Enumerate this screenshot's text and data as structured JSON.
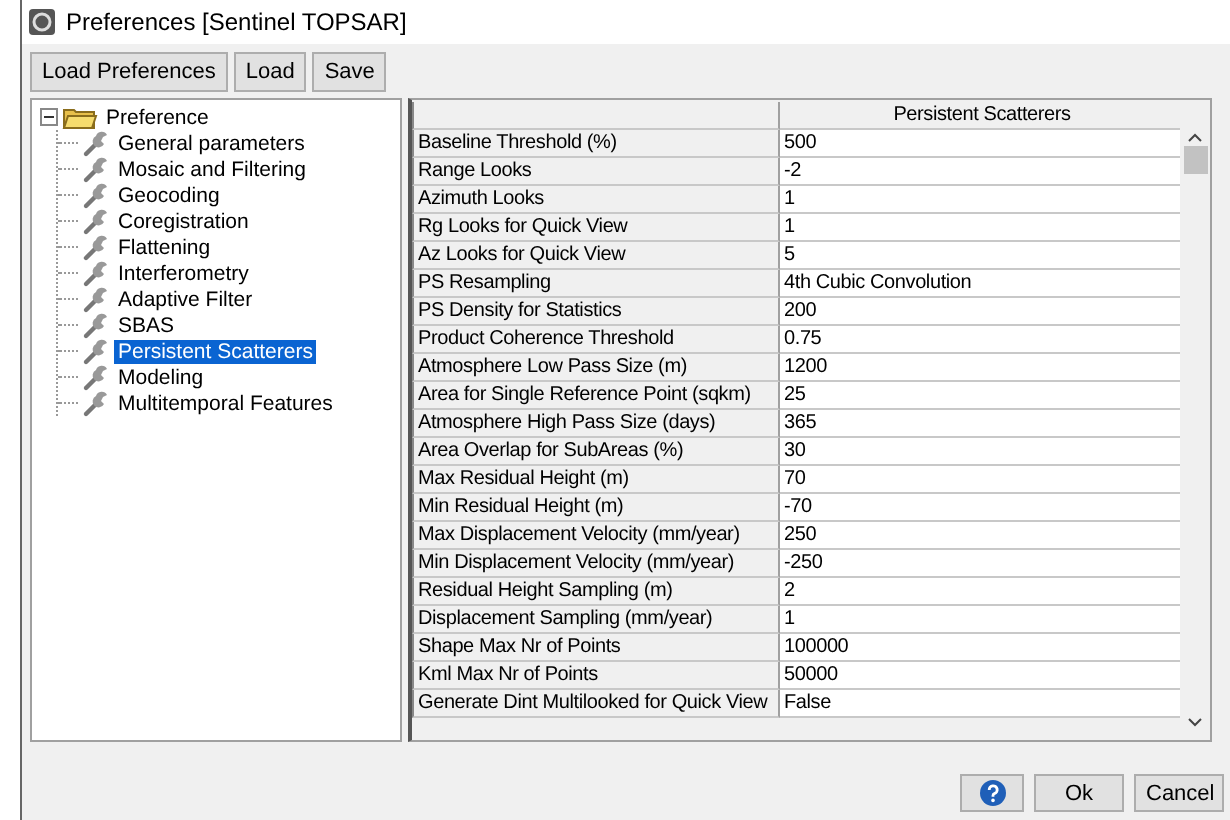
{
  "window": {
    "title": "Preferences [Sentinel TOPSAR]"
  },
  "toolbar": [
    "Load Preferences",
    "Load",
    "Save"
  ],
  "tree": {
    "label": "Preference",
    "expanded": true,
    "children": [
      {
        "label": "General parameters",
        "selected": false
      },
      {
        "label": "Mosaic and Filtering",
        "selected": false
      },
      {
        "label": "Geocoding",
        "selected": false
      },
      {
        "label": "Coregistration",
        "selected": false
      },
      {
        "label": "Flattening",
        "selected": false
      },
      {
        "label": "Interferometry",
        "selected": false
      },
      {
        "label": "Adaptive Filter",
        "selected": false
      },
      {
        "label": "SBAS",
        "selected": false
      },
      {
        "label": "Persistent Scatterers",
        "selected": true
      },
      {
        "label": "Modeling",
        "selected": false
      },
      {
        "label": "Multitemporal Features",
        "selected": false
      }
    ]
  },
  "grid": {
    "column_header": "Persistent Scatterers",
    "rows": [
      {
        "name": "Baseline Threshold (%)",
        "value": "500"
      },
      {
        "name": "Range Looks",
        "value": "-2"
      },
      {
        "name": "Azimuth Looks",
        "value": "1"
      },
      {
        "name": "Rg Looks for Quick View",
        "value": "1"
      },
      {
        "name": "Az Looks for Quick View",
        "value": "5"
      },
      {
        "name": "PS Resampling",
        "value": "4th Cubic Convolution"
      },
      {
        "name": "PS Density for Statistics",
        "value": "200"
      },
      {
        "name": "Product Coherence Threshold",
        "value": "0.75"
      },
      {
        "name": "Atmosphere Low Pass Size (m)",
        "value": "1200"
      },
      {
        "name": "Area for Single Reference Point (sqkm)",
        "value": "25"
      },
      {
        "name": "Atmosphere High Pass Size (days)",
        "value": "365"
      },
      {
        "name": "Area Overlap for SubAreas (%)",
        "value": "30"
      },
      {
        "name": "Max Residual Height (m)",
        "value": "70"
      },
      {
        "name": "Min Residual Height (m)",
        "value": "-70"
      },
      {
        "name": "Max Displacement Velocity (mm/year)",
        "value": "250"
      },
      {
        "name": "Min Displacement Velocity (mm/year)",
        "value": "-250"
      },
      {
        "name": "Residual Height Sampling (m)",
        "value": "2"
      },
      {
        "name": "Displacement Sampling (mm/year)",
        "value": "1"
      },
      {
        "name": "Shape Max Nr of Points",
        "value": "100000"
      },
      {
        "name": "Kml Max Nr of Points",
        "value": "50000"
      },
      {
        "name": "Generate Dint Multilooked for Quick View",
        "value": "False"
      }
    ]
  },
  "footer": {
    "buttons": [
      {
        "kind": "help"
      },
      {
        "kind": "text",
        "label": "Ok"
      },
      {
        "kind": "text",
        "label": "Cancel"
      }
    ]
  }
}
